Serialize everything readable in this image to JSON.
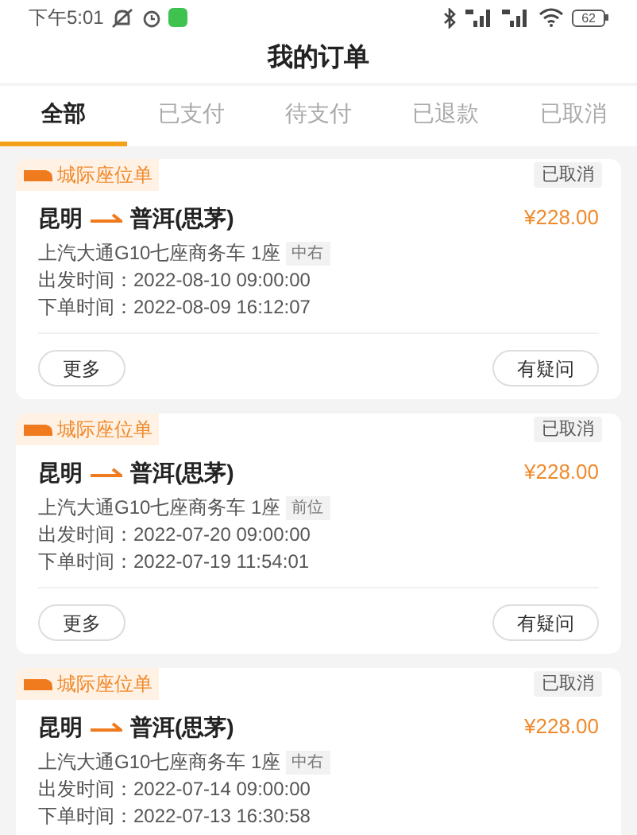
{
  "status_bar": {
    "time": "下午5:01",
    "battery": "62"
  },
  "title": "我的订单",
  "tabs": [
    {
      "label": "全部",
      "selected": true
    },
    {
      "label": "已支付",
      "selected": false
    },
    {
      "label": "待支付",
      "selected": false
    },
    {
      "label": "已退款",
      "selected": false
    },
    {
      "label": "已取消",
      "selected": false
    }
  ],
  "orders": [
    {
      "type": "城际座位单",
      "status": "已取消",
      "from": "昆明",
      "to": "普洱(思茅)",
      "price": "¥228.00",
      "vehicle": "上汽大通G10七座商务车 1座",
      "seat": "中右",
      "depart": "出发时间：2022-08-10 09:00:00",
      "ordered": "下单时间：2022-08-09 16:12:07",
      "buttons": [
        "更多",
        "有疑问"
      ]
    },
    {
      "type": "城际座位单",
      "status": "已取消",
      "from": "昆明",
      "to": "普洱(思茅)",
      "price": "¥228.00",
      "vehicle": "上汽大通G10七座商务车 1座",
      "seat": "前位",
      "depart": "出发时间：2022-07-20 09:00:00",
      "ordered": "下单时间：2022-07-19 11:54:01",
      "buttons": [
        "更多",
        "有疑问"
      ]
    },
    {
      "type": "城际座位单",
      "status": "已取消",
      "from": "昆明",
      "to": "普洱(思茅)",
      "price": "¥228.00",
      "vehicle": "上汽大通G10七座商务车 1座",
      "seat": "中右",
      "depart": "出发时间：2022-07-14 09:00:00",
      "ordered": "下单时间：2022-07-13 16:30:58"
    }
  ]
}
